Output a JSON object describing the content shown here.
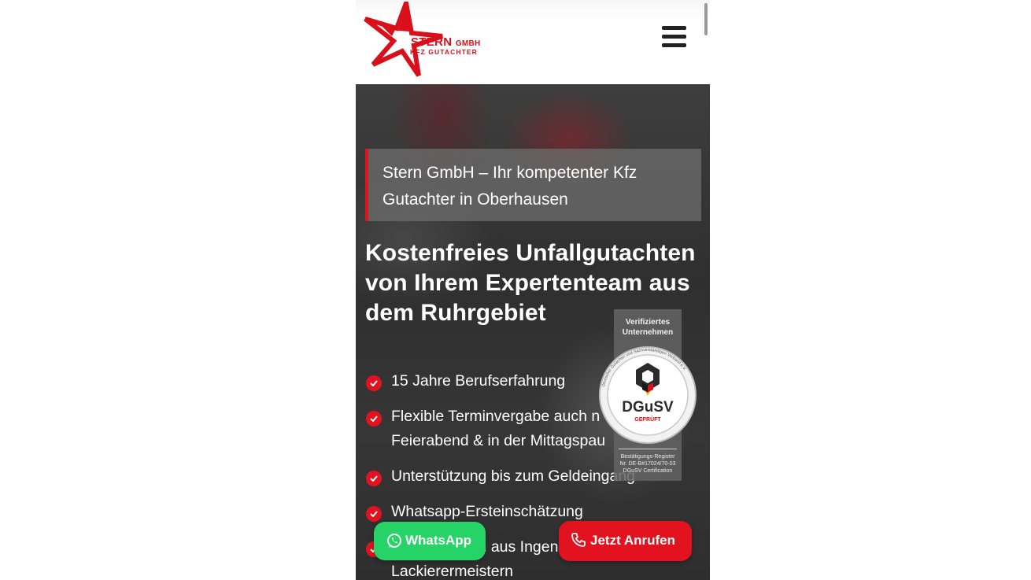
{
  "brand": {
    "name_main": "STERN",
    "name_suffix": "GMBH",
    "subtitle": "KFZ GUTACHTER",
    "color": "#d9101b"
  },
  "header": {
    "menu_icon": "hamburger-menu-icon"
  },
  "hero": {
    "tagline": "Stern GmbH – Ihr kompetenter Kfz Gutachter in Oberhausen",
    "headline": "Kostenfreies Unfallgutachten von Ihrem Expertenteam aus dem Ruhrgebiet",
    "features": [
      {
        "label": "15 Jahre Berufserfahrung",
        "label2": ""
      },
      {
        "label": "Flexible Terminvergabe auch n",
        "label2": "Feierabend & in der Mittagspau"
      },
      {
        "label": "Unterstützung bis zum Geldeingang",
        "label2": ""
      },
      {
        "label": "Whatsapp-Ersteinschätzung",
        "label2": ""
      },
      {
        "label": "Expertenteam aus Ingenieuren und",
        "label2": "Lackierermeistern"
      }
    ],
    "check_icon": "check-circle-icon",
    "accent_color": "#e2131f"
  },
  "badge": {
    "top_text": "Verifiziertes Unternehmen",
    "seal_title": "DGuSV",
    "seal_sub": "GEPRÜFT",
    "seal_ring": "Deutscher Gutachter und Sachverständigen Verband e.V.",
    "bottom_line1": "Bestätigungs-Register",
    "bottom_line2": "Nr. DE-B#17024/70-03",
    "bottom_line3": "DGuSV Certification"
  },
  "actions": {
    "whatsapp_label": "WhatsApp",
    "whatsapp_icon": "whatsapp-icon",
    "whatsapp_color": "#25d366",
    "call_label": "Jetzt Anrufen",
    "call_icon": "phone-icon",
    "call_color": "#e2131f"
  }
}
